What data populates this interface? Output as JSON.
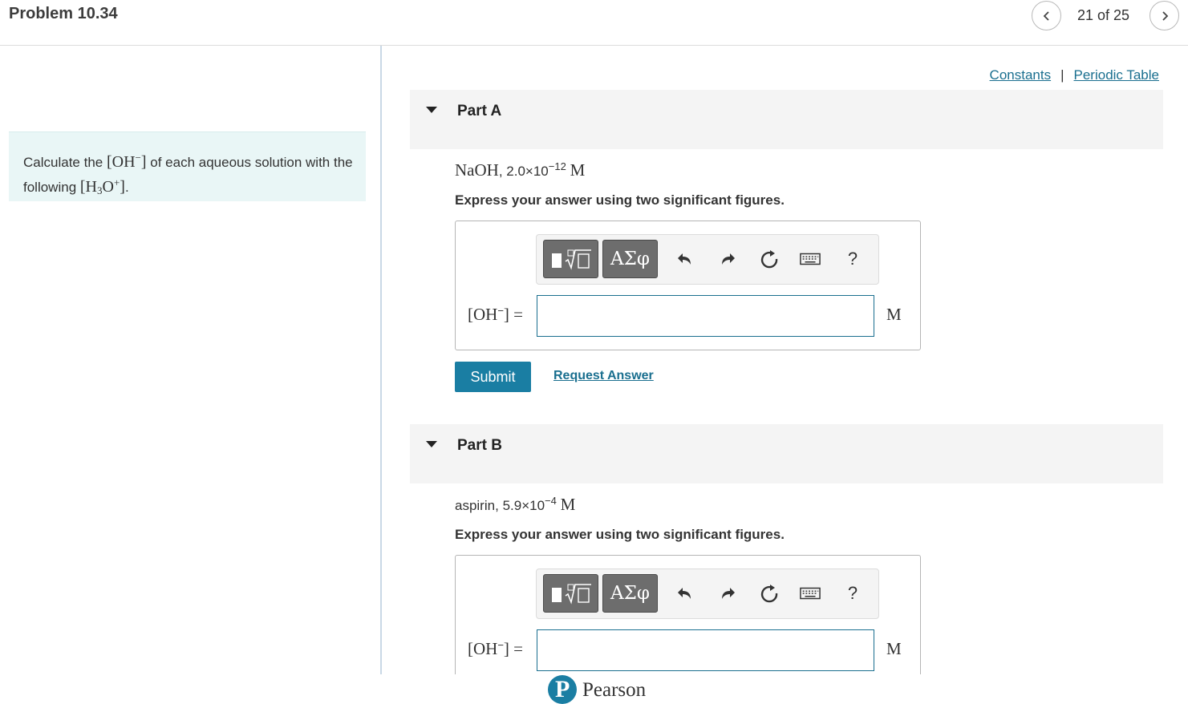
{
  "header": {
    "title": "Problem 10.34",
    "counter": "21 of 25",
    "prev_icon": "chevron-left-icon",
    "next_icon": "chevron-right-icon"
  },
  "intro": {
    "text_before": "Calculate the",
    "oh_base": "[OH",
    "oh_sup": "−",
    "oh_close": "]",
    "text_middle": "of each aqueous solution with the following",
    "h3o_base": "[H",
    "h3o_sub": "3",
    "h3o_o": "O",
    "h3o_sup": "+",
    "h3o_close": "]",
    "text_end": "."
  },
  "links": {
    "constants": "Constants",
    "separator": "|",
    "periodic_table": "Periodic Table"
  },
  "parts": [
    {
      "label": "Part A",
      "compound": "NaOH",
      "compound_sep": ",",
      "conc_mantissa": "2.0×10",
      "conc_exp": "−12",
      "conc_unit": "M",
      "instruction": "Express your answer using two significant figures.",
      "eq_base": "[OH",
      "eq_sup": "−",
      "eq_close": "] =",
      "input_value": "",
      "unit": "M",
      "submit": "Submit",
      "request": "Request Answer"
    },
    {
      "label": "Part B",
      "compound": "aspirin",
      "compound_sep": ",",
      "conc_mantissa": "5.9×10",
      "conc_exp": "−4",
      "conc_unit": "M",
      "instruction": "Express your answer using two significant figures.",
      "eq_base": "[OH",
      "eq_sup": "−",
      "eq_close": "] =",
      "input_value": "",
      "unit": "M"
    }
  ],
  "toolbar": {
    "greek_label": "ΑΣφ",
    "help_label": "?",
    "icons": [
      "templates-icon",
      "undo-icon",
      "redo-icon",
      "reset-icon",
      "keyboard-icon"
    ]
  },
  "footer": {
    "logo_letter": "P",
    "brand": "Pearson"
  },
  "colors": {
    "accent": "#1a7ea3",
    "link": "#1a6f8f",
    "intro_bg": "#e9f6f6",
    "part_header_bg": "#f4f4f4",
    "toolbar_button": "#6d6d6d"
  }
}
